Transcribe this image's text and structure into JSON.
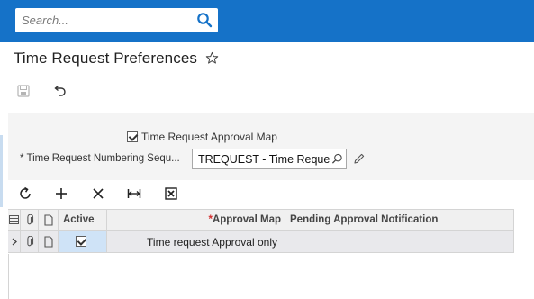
{
  "search": {
    "placeholder": "Search..."
  },
  "page": {
    "title": "Time Request Preferences"
  },
  "form": {
    "approval_map_label": "Time Request Approval Map",
    "approval_map_checked": true,
    "numbering_label": "Time Request Numbering Sequ...",
    "numbering_required_marker": "*",
    "numbering_value": "TREQUEST - Time Request"
  },
  "grid": {
    "columns": {
      "active": "Active",
      "approval_map": "Approval Map",
      "approval_map_required_marker": "*",
      "pending_notification": "Pending Approval Notification"
    },
    "rows": [
      {
        "active": true,
        "approval_map": "Time request Approval only",
        "pending_notification": ""
      }
    ]
  },
  "icons": {
    "toolbar": [
      "save-icon",
      "undo-icon"
    ],
    "grid_toolbar": [
      "refresh-icon",
      "add-icon",
      "delete-icon",
      "fit-columns-icon",
      "export-excel-icon"
    ]
  },
  "colors": {
    "topbar": "#1572c8",
    "selected_cell": "#cfe3f7",
    "required": "#d32f2f"
  }
}
